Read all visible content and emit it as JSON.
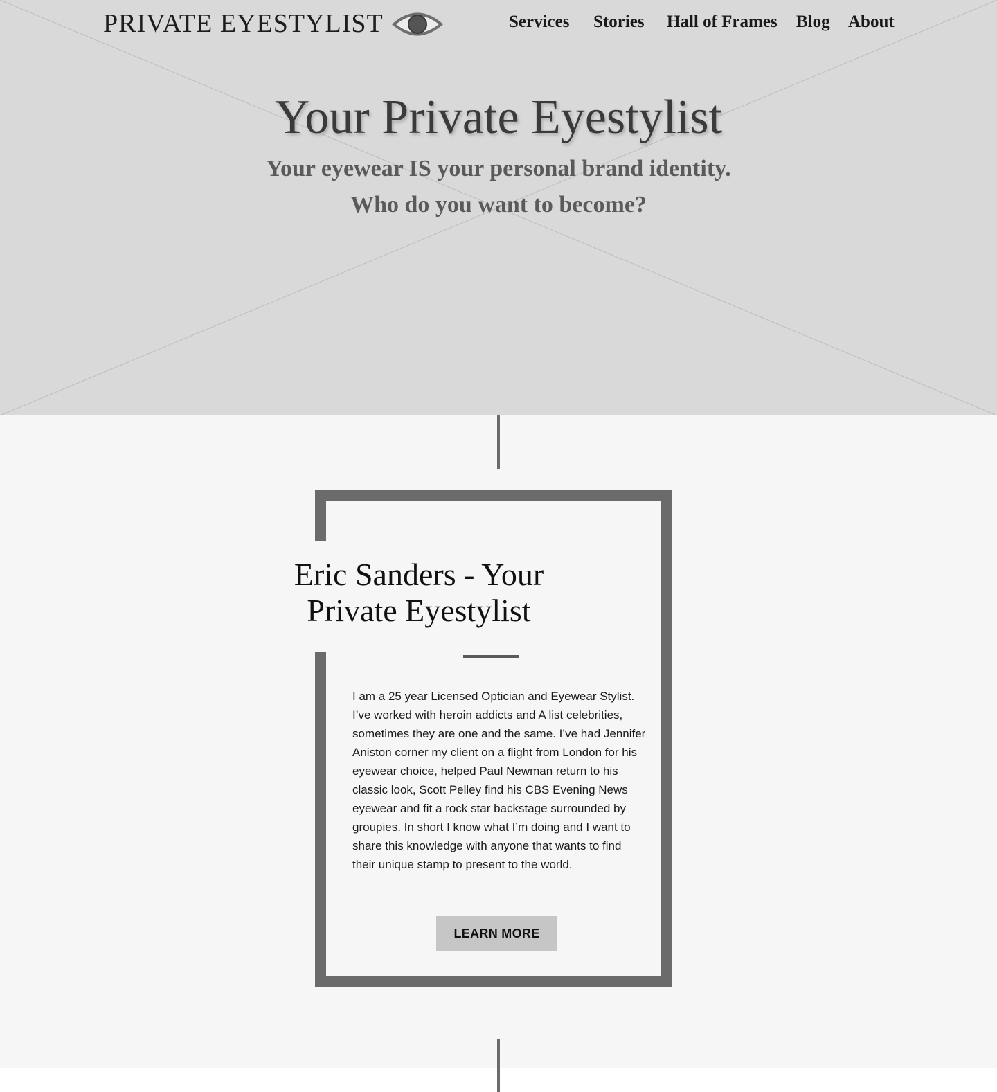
{
  "header": {
    "logo_text": "PRIVATE EYESTYLIST",
    "logo_icon": "eye-icon",
    "nav": [
      {
        "label": "Services"
      },
      {
        "label": "Stories"
      },
      {
        "label": "Hall of Frames"
      },
      {
        "label": "Blog"
      },
      {
        "label": "About"
      }
    ]
  },
  "hero": {
    "title": "Your Private Eyestylist",
    "subtitle_line1": "Your eyewear IS your personal brand identity.",
    "subtitle_line2": "Who do you want to become?",
    "background_placeholder": "image-placeholder"
  },
  "about": {
    "title_line1": "Eric Sanders - Your",
    "title_line2": "Private Eyestylist",
    "body": "I am a 25 year Licensed Optician and Eyewear Stylist. I’ve worked with heroin addicts and A list celebrities, sometimes they are one and the same. I’ve had Jennifer Aniston corner my client on a flight from London for his eyewear choice, helped Paul Newman return to his classic look, Scott Pelley find his CBS Evening News eyewear and fit a rock star backstage surrounded by groupies. In short I know what I’m doing and I want to share this knowledge with anyone that wants to find their unique stamp to present to the world.",
    "button_label": "LEARN MORE"
  },
  "colors": {
    "hero_bg": "#d9d9d9",
    "section_bg": "#f6f6f6",
    "frame": "#6b6b6b",
    "button_bg": "#c6c6c6"
  }
}
